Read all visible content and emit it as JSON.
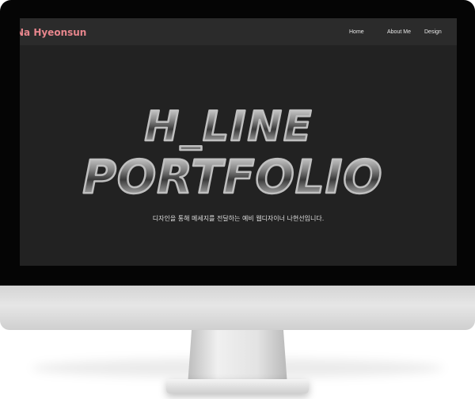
{
  "header": {
    "brand": "Na Hyeonsun",
    "nav": [
      "Home",
      "About Me",
      "Design"
    ]
  },
  "hero": {
    "title_line1": "H_LINE",
    "title_line2": "PORTFOLIO",
    "subtitle": "디자인을 통해 메세지를 전달하는 예비 웹디자이너 나현선입니다."
  },
  "colors": {
    "brand": "#e8868d",
    "screen_bg": "#222222",
    "topbar_bg": "#2b2b2b",
    "bezel": "#050505"
  }
}
